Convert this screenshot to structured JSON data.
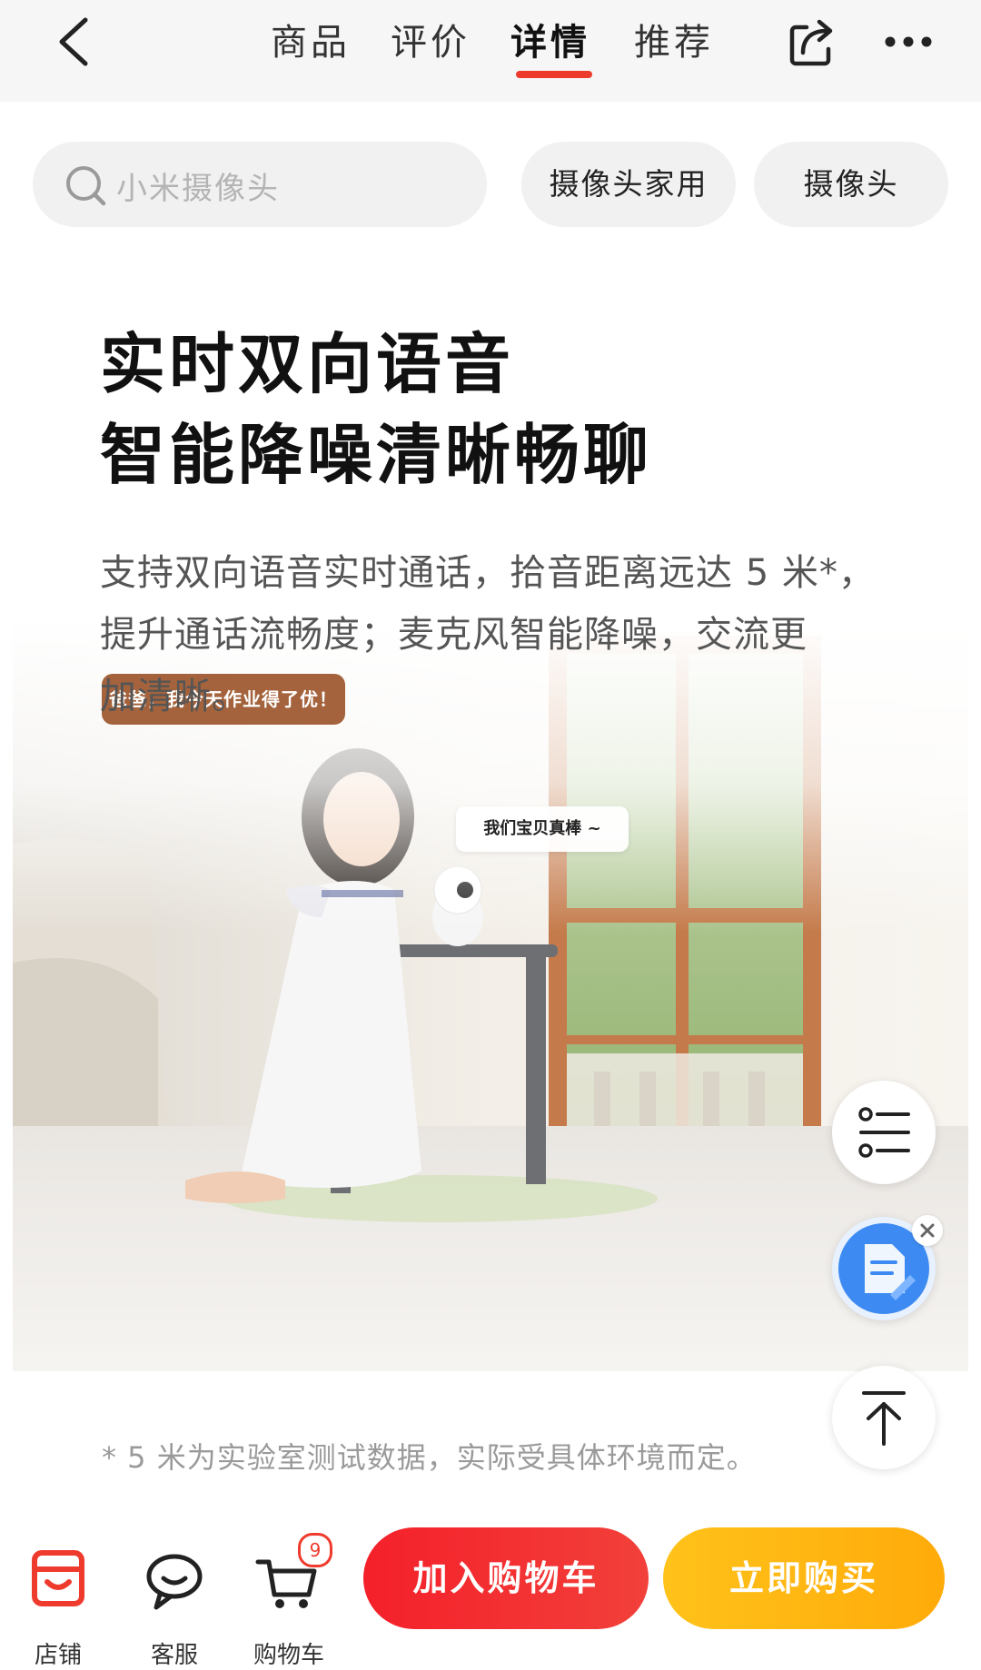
{
  "nav": {
    "tabs": [
      {
        "label": "商品",
        "active": false
      },
      {
        "label": "评价",
        "active": false
      },
      {
        "label": "详情",
        "active": true
      },
      {
        "label": "推荐",
        "active": false
      }
    ],
    "icons": {
      "back": "chevron-left-icon",
      "share": "share-icon",
      "more": "more-icon"
    },
    "accent_color": "#ee3a2c"
  },
  "search": {
    "placeholder": "小米摄像头",
    "chips": [
      "摄像头家用",
      "摄像头"
    ]
  },
  "content": {
    "headline": [
      "实时双向语音",
      "智能降噪清晰畅聊"
    ],
    "description": [
      "支持双向语音实时通话，拾音距离远达 5 米*，",
      "提升通话流畅度；麦克风智能降噪，交流更",
      "加清晰。"
    ],
    "photo": {
      "bubble_left": "爸爸，我今天作业得了优！",
      "bubble_right": "我们宝贝真棒 ~"
    },
    "footnote": "* 5 米为实验室测试数据，实际受具体环境而定。"
  },
  "floating": {
    "list_icon": "list-icon",
    "assistant_icon": "document-assistant-icon",
    "top_icon": "arrow-up-icon"
  },
  "bottom_bar": {
    "items": [
      {
        "label": "店铺",
        "icon": "store-icon"
      },
      {
        "label": "客服",
        "icon": "customer-service-icon"
      },
      {
        "label": "购物车",
        "icon": "cart-icon",
        "badge": "9"
      }
    ],
    "add_to_cart": "加入购物车",
    "buy_now": "立即购买",
    "cart_color": "#f4202a",
    "buy_color": "#ffb20f"
  }
}
